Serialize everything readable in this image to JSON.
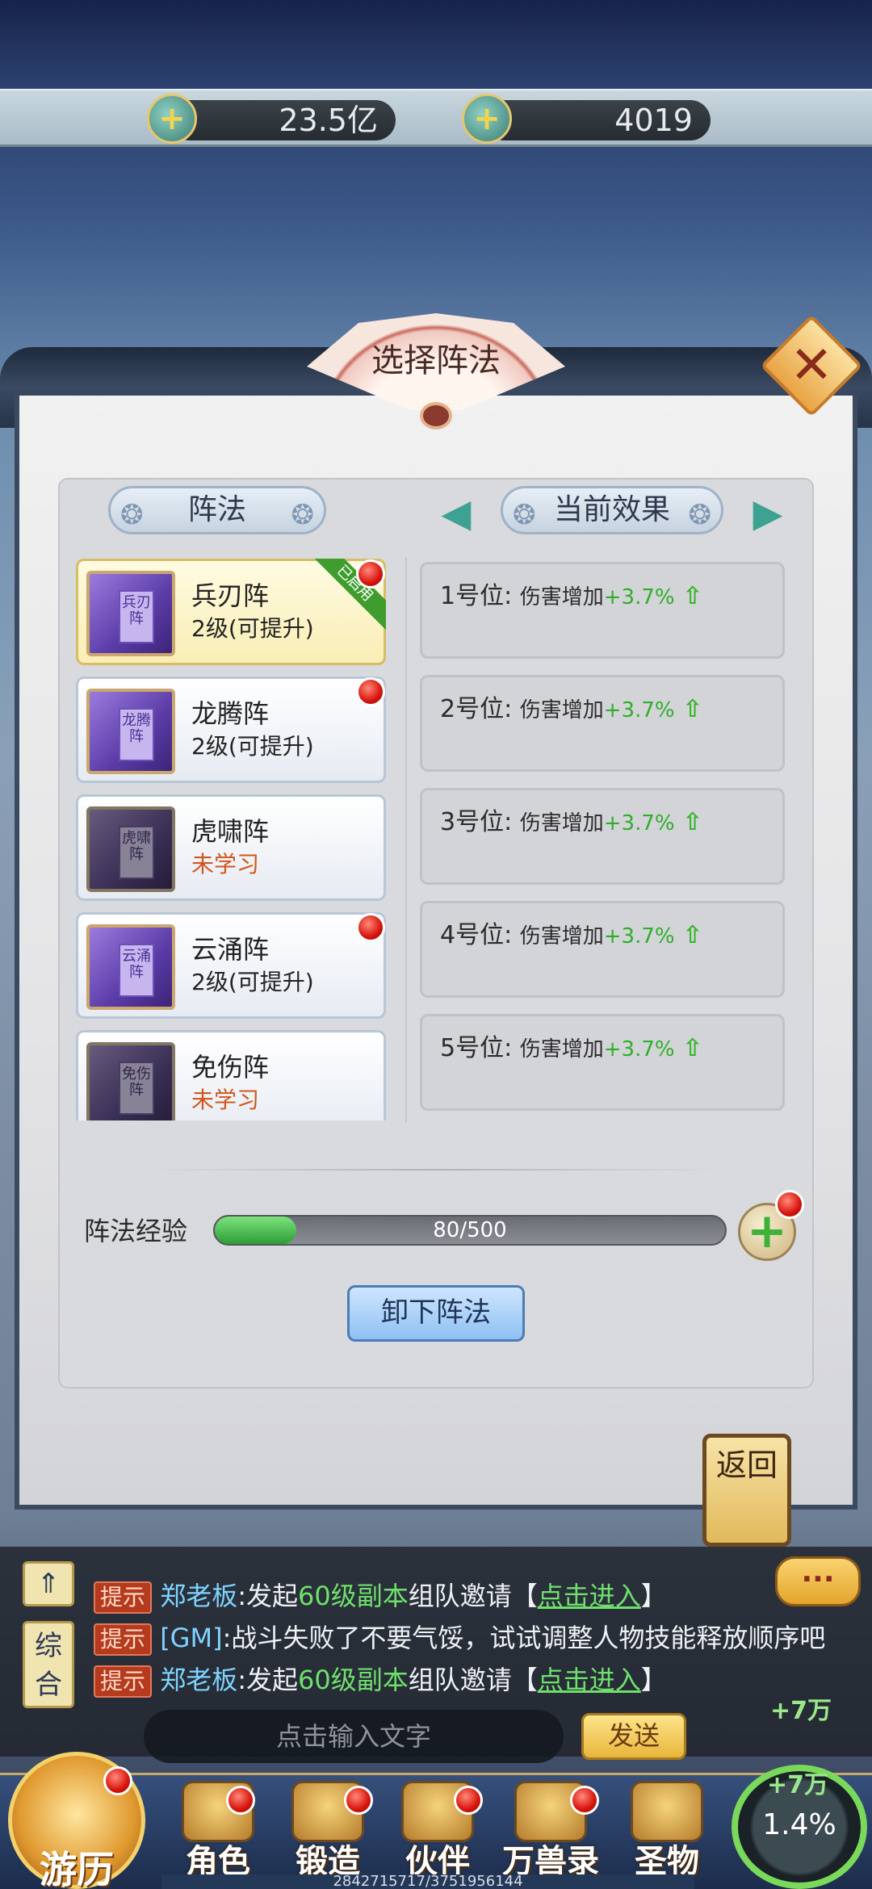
{
  "currency": {
    "gold": "23.5亿",
    "jade": "4019"
  },
  "dialog": {
    "title": "选择阵法",
    "close_label": "✕"
  },
  "headers": {
    "formations": "阵法",
    "effects": "当前效果"
  },
  "formations": [
    {
      "name": "兵刃阵",
      "level": "2级(可提升)",
      "book": "兵刃阵",
      "selected": true,
      "in_use": "已启用"
    },
    {
      "name": "龙腾阵",
      "level": "2级(可提升)",
      "book": "龙腾阵"
    },
    {
      "name": "虎啸阵",
      "level": "未学习",
      "book": "虎啸阵"
    },
    {
      "name": "云涌阵",
      "level": "2级(可提升)",
      "book": "云涌阵"
    },
    {
      "name": "免伤阵",
      "level": "未学习",
      "book": "免伤阵"
    }
  ],
  "effects": [
    {
      "pos": "1号位:",
      "effect": "伤害增加",
      "bonus": "+3.7%"
    },
    {
      "pos": "2号位:",
      "effect": "伤害增加",
      "bonus": "+3.7%"
    },
    {
      "pos": "3号位:",
      "effect": "伤害增加",
      "bonus": "+3.7%"
    },
    {
      "pos": "4号位:",
      "effect": "伤害增加",
      "bonus": "+3.7%"
    },
    {
      "pos": "5号位:",
      "effect": "伤害增加",
      "bonus": "+3.7%"
    }
  ],
  "exp": {
    "label": "阵法经验",
    "value": "80/500",
    "fraction": 0.16
  },
  "buttons": {
    "unload": "卸下阵法",
    "return": "返回"
  },
  "chat": {
    "channel_label": "综合",
    "lines": [
      {
        "tag": "提示",
        "sender": "郑老板",
        "pre": ":发起",
        "level": "60级副本",
        "post": "组队邀请【",
        "link": "点击进入",
        "end": "】"
      },
      {
        "tag": "提示",
        "sender": "[GM]",
        "text": ":战斗失败了不要气馁，试试调整人物技能释放顺序吧"
      },
      {
        "tag": "提示",
        "sender": "郑老板",
        "pre": ":发起",
        "level": "60级副本",
        "post": "组队邀请【",
        "link": "点击进入",
        "end": "】"
      }
    ],
    "input_placeholder": "点击输入文字",
    "send_label": "发送",
    "gain_1": "+7万",
    "gain_2": "+7万"
  },
  "bottom_nav": {
    "explore": "游历",
    "items": [
      "角色",
      "锻造",
      "伙伴",
      "万兽录",
      "圣物"
    ],
    "progress": "1.4%",
    "exp_counter": "2842715717/3751956144"
  }
}
